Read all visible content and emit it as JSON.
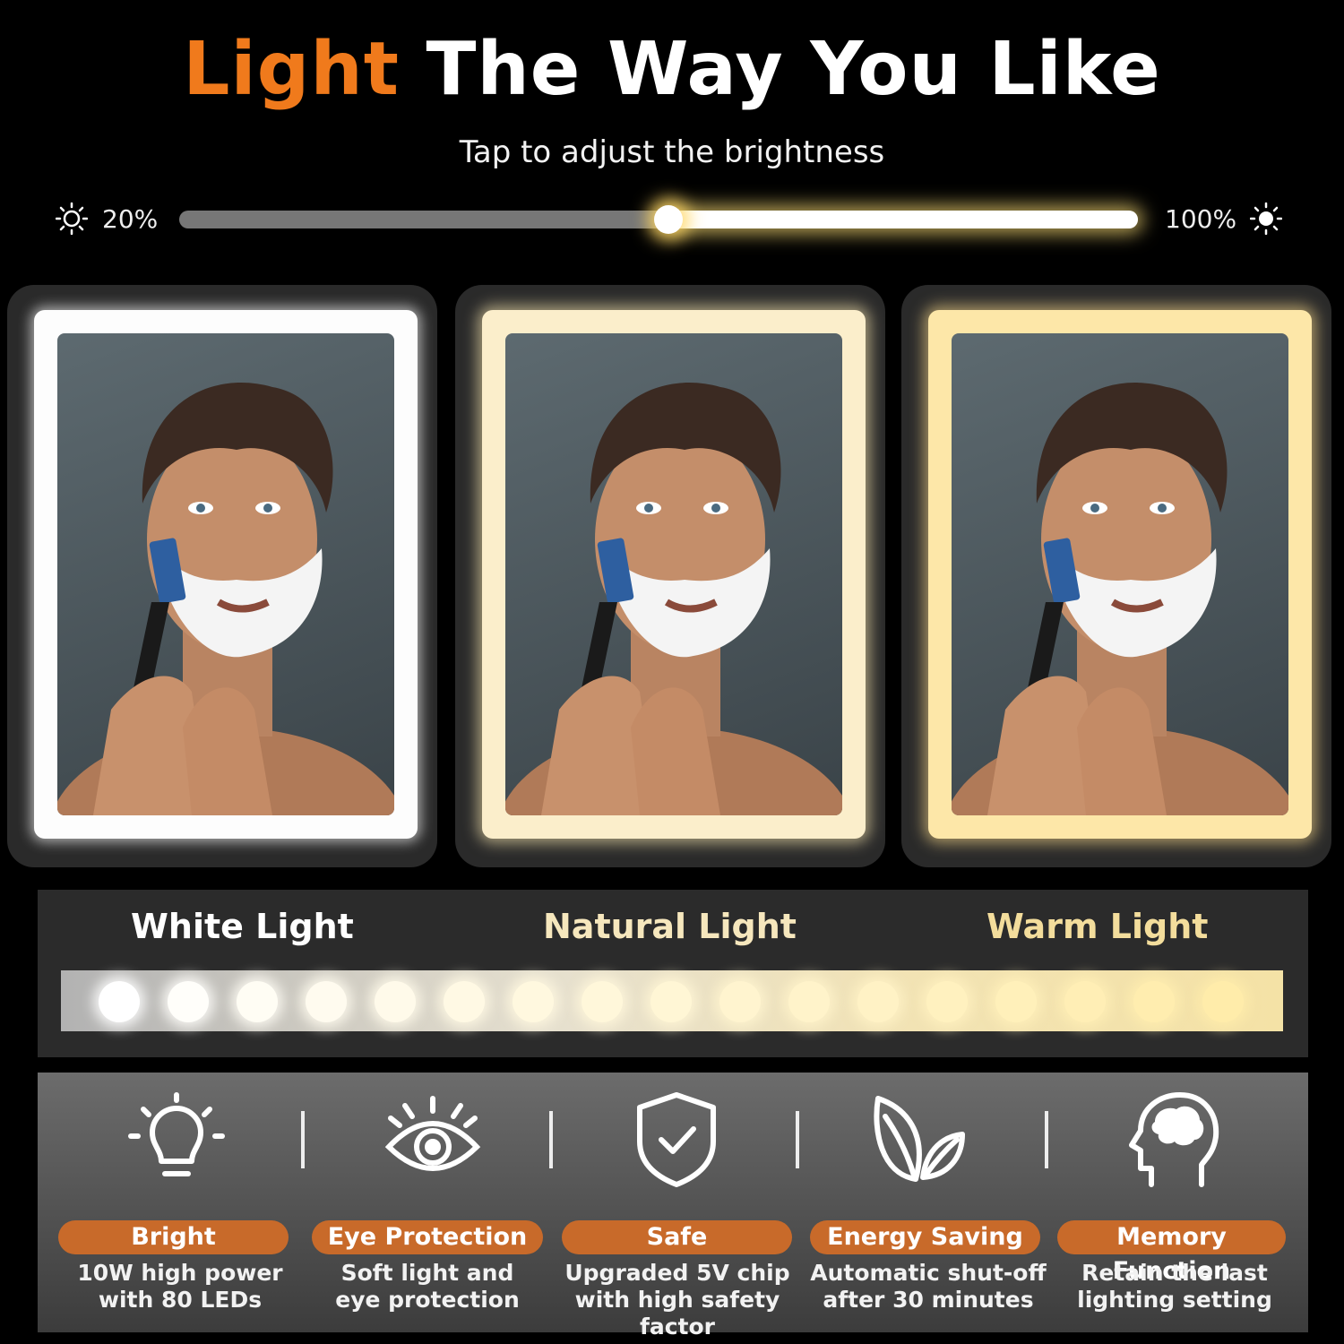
{
  "header": {
    "title_accent": "Light",
    "title_rest": " The Way You Like",
    "subtitle": "Tap to adjust the brightness"
  },
  "brightness": {
    "min_label": "20%",
    "max_label": "100%",
    "level": 0.51,
    "min_icon": "sun-outline-icon",
    "max_icon": "sun-filled-icon"
  },
  "mirrors": [
    {
      "mode": "white",
      "glow": "#ffffff"
    },
    {
      "mode": "natural",
      "glow": "#fff0c8"
    },
    {
      "mode": "warm",
      "glow": "#ffe7a8"
    }
  ],
  "light_modes": {
    "labels": [
      "White Light",
      "Natural Light",
      "Warm Light"
    ],
    "label_colors": [
      "#ffffff",
      "#f6e7bd",
      "#f3dd9c"
    ],
    "bulb_count": 17
  },
  "features": [
    {
      "icon": "lightbulb-icon",
      "title": "Bright",
      "line1": "10W high power",
      "line2": "with 80 LEDs"
    },
    {
      "icon": "eye-icon",
      "title": "Eye Protection",
      "line1": "Soft light and",
      "line2": "eye protection"
    },
    {
      "icon": "shield-check-icon",
      "title": "Safe",
      "line1": "Upgraded 5V chip",
      "line2": "with high safety factor"
    },
    {
      "icon": "leaf-icon",
      "title": "Energy Saving",
      "line1": "Automatic shut-off",
      "line2": "after 30 minutes"
    },
    {
      "icon": "brain-head-icon",
      "title": "Memory Function",
      "line1": "Retain the last",
      "line2": "lighting setting"
    }
  ],
  "colors": {
    "accent": "#f07a1c",
    "pill": "#c86a2a"
  }
}
